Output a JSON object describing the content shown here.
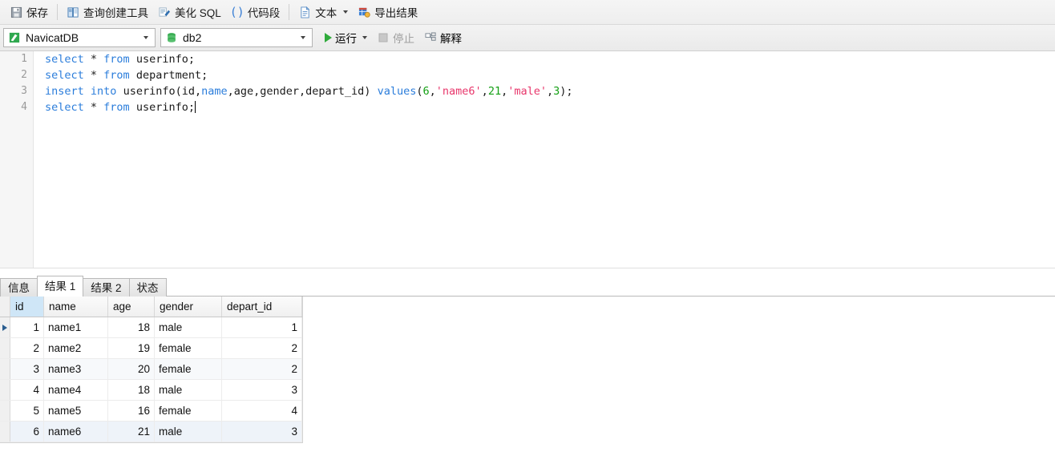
{
  "toolbar_top": {
    "items": [
      {
        "id": "save",
        "label": "保存",
        "icon": "save-icon"
      },
      {
        "id": "query-builder",
        "label": "查询创建工具",
        "icon": "query-builder-icon"
      },
      {
        "id": "beautify-sql",
        "label": "美化 SQL",
        "icon": "beautify-icon"
      },
      {
        "id": "code-snippet",
        "label": "代码段",
        "icon": "code-snippet-icon"
      },
      {
        "id": "text",
        "label": "文本",
        "icon": "text-icon",
        "has_caret": true
      },
      {
        "id": "export-result",
        "label": "导出结果",
        "icon": "export-icon"
      }
    ]
  },
  "toolbar_second": {
    "connection": {
      "value": "NavicatDB",
      "icon": "connection-icon"
    },
    "database": {
      "value": "db2",
      "icon": "database-icon"
    },
    "run": {
      "label": "运行",
      "enabled": true,
      "icon": "play-icon",
      "has_caret": true
    },
    "stop": {
      "label": "停止",
      "enabled": false,
      "icon": "stop-icon"
    },
    "explain": {
      "label": "解释",
      "enabled": true,
      "icon": "explain-icon"
    }
  },
  "editor": {
    "line_numbers": [
      "1",
      "2",
      "3",
      "4"
    ],
    "lines": [
      [
        {
          "t": "select",
          "c": "kw"
        },
        {
          "t": " * ",
          "c": "pln"
        },
        {
          "t": "from",
          "c": "kw"
        },
        {
          "t": " userinfo;",
          "c": "pln"
        }
      ],
      [
        {
          "t": "select",
          "c": "kw"
        },
        {
          "t": " * ",
          "c": "pln"
        },
        {
          "t": "from",
          "c": "kw"
        },
        {
          "t": " department;",
          "c": "pln"
        }
      ],
      [
        {
          "t": "insert",
          "c": "kw"
        },
        {
          "t": " ",
          "c": "pln"
        },
        {
          "t": "into",
          "c": "kw"
        },
        {
          "t": " userinfo(id,",
          "c": "pln"
        },
        {
          "t": "name",
          "c": "kw"
        },
        {
          "t": ",age,gender,depart_id) ",
          "c": "pln"
        },
        {
          "t": "values",
          "c": "kw"
        },
        {
          "t": "(",
          "c": "pln"
        },
        {
          "t": "6",
          "c": "num"
        },
        {
          "t": ",",
          "c": "pln"
        },
        {
          "t": "'name6'",
          "c": "str"
        },
        {
          "t": ",",
          "c": "pln"
        },
        {
          "t": "21",
          "c": "num"
        },
        {
          "t": ",",
          "c": "pln"
        },
        {
          "t": "'male'",
          "c": "str"
        },
        {
          "t": ",",
          "c": "pln"
        },
        {
          "t": "3",
          "c": "num"
        },
        {
          "t": ");",
          "c": "pln"
        }
      ],
      [
        {
          "t": "select",
          "c": "kw"
        },
        {
          "t": " * ",
          "c": "pln"
        },
        {
          "t": "from",
          "c": "kw"
        },
        {
          "t": " userinfo;",
          "c": "pln"
        }
      ]
    ]
  },
  "result_tabs": [
    {
      "label": "信息",
      "active": false
    },
    {
      "label": "结果 1",
      "active": true
    },
    {
      "label": "结果 2",
      "active": false
    },
    {
      "label": "状态",
      "active": false
    }
  ],
  "grid": {
    "columns": [
      {
        "key": "id",
        "label": "id",
        "align": "right",
        "selected": true
      },
      {
        "key": "name",
        "label": "name",
        "align": "left",
        "selected": false
      },
      {
        "key": "age",
        "label": "age",
        "align": "right",
        "selected": false
      },
      {
        "key": "gender",
        "label": "gender",
        "align": "left",
        "selected": false
      },
      {
        "key": "depart_id",
        "label": "depart_id",
        "align": "right",
        "selected": false
      }
    ],
    "rows": [
      {
        "id": "1",
        "name": "name1",
        "age": "18",
        "gender": "male",
        "depart_id": "1",
        "current": true,
        "style": "plain"
      },
      {
        "id": "2",
        "name": "name2",
        "age": "19",
        "gender": "female",
        "depart_id": "2",
        "current": false,
        "style": "plain"
      },
      {
        "id": "3",
        "name": "name3",
        "age": "20",
        "gender": "female",
        "depart_id": "2",
        "current": false,
        "style": "alt"
      },
      {
        "id": "4",
        "name": "name4",
        "age": "18",
        "gender": "male",
        "depart_id": "3",
        "current": false,
        "style": "plain"
      },
      {
        "id": "5",
        "name": "name5",
        "age": "16",
        "gender": "female",
        "depart_id": "4",
        "current": false,
        "style": "plain"
      },
      {
        "id": "6",
        "name": "name6",
        "age": "21",
        "gender": "male",
        "depart_id": "3",
        "current": false,
        "style": "tinted"
      }
    ]
  },
  "colors": {
    "keyword": "#2b7ddb",
    "number": "#15a015",
    "string": "#e8366b",
    "selected_header": "#cfe6f7",
    "run_green": "#2eaa3a"
  }
}
